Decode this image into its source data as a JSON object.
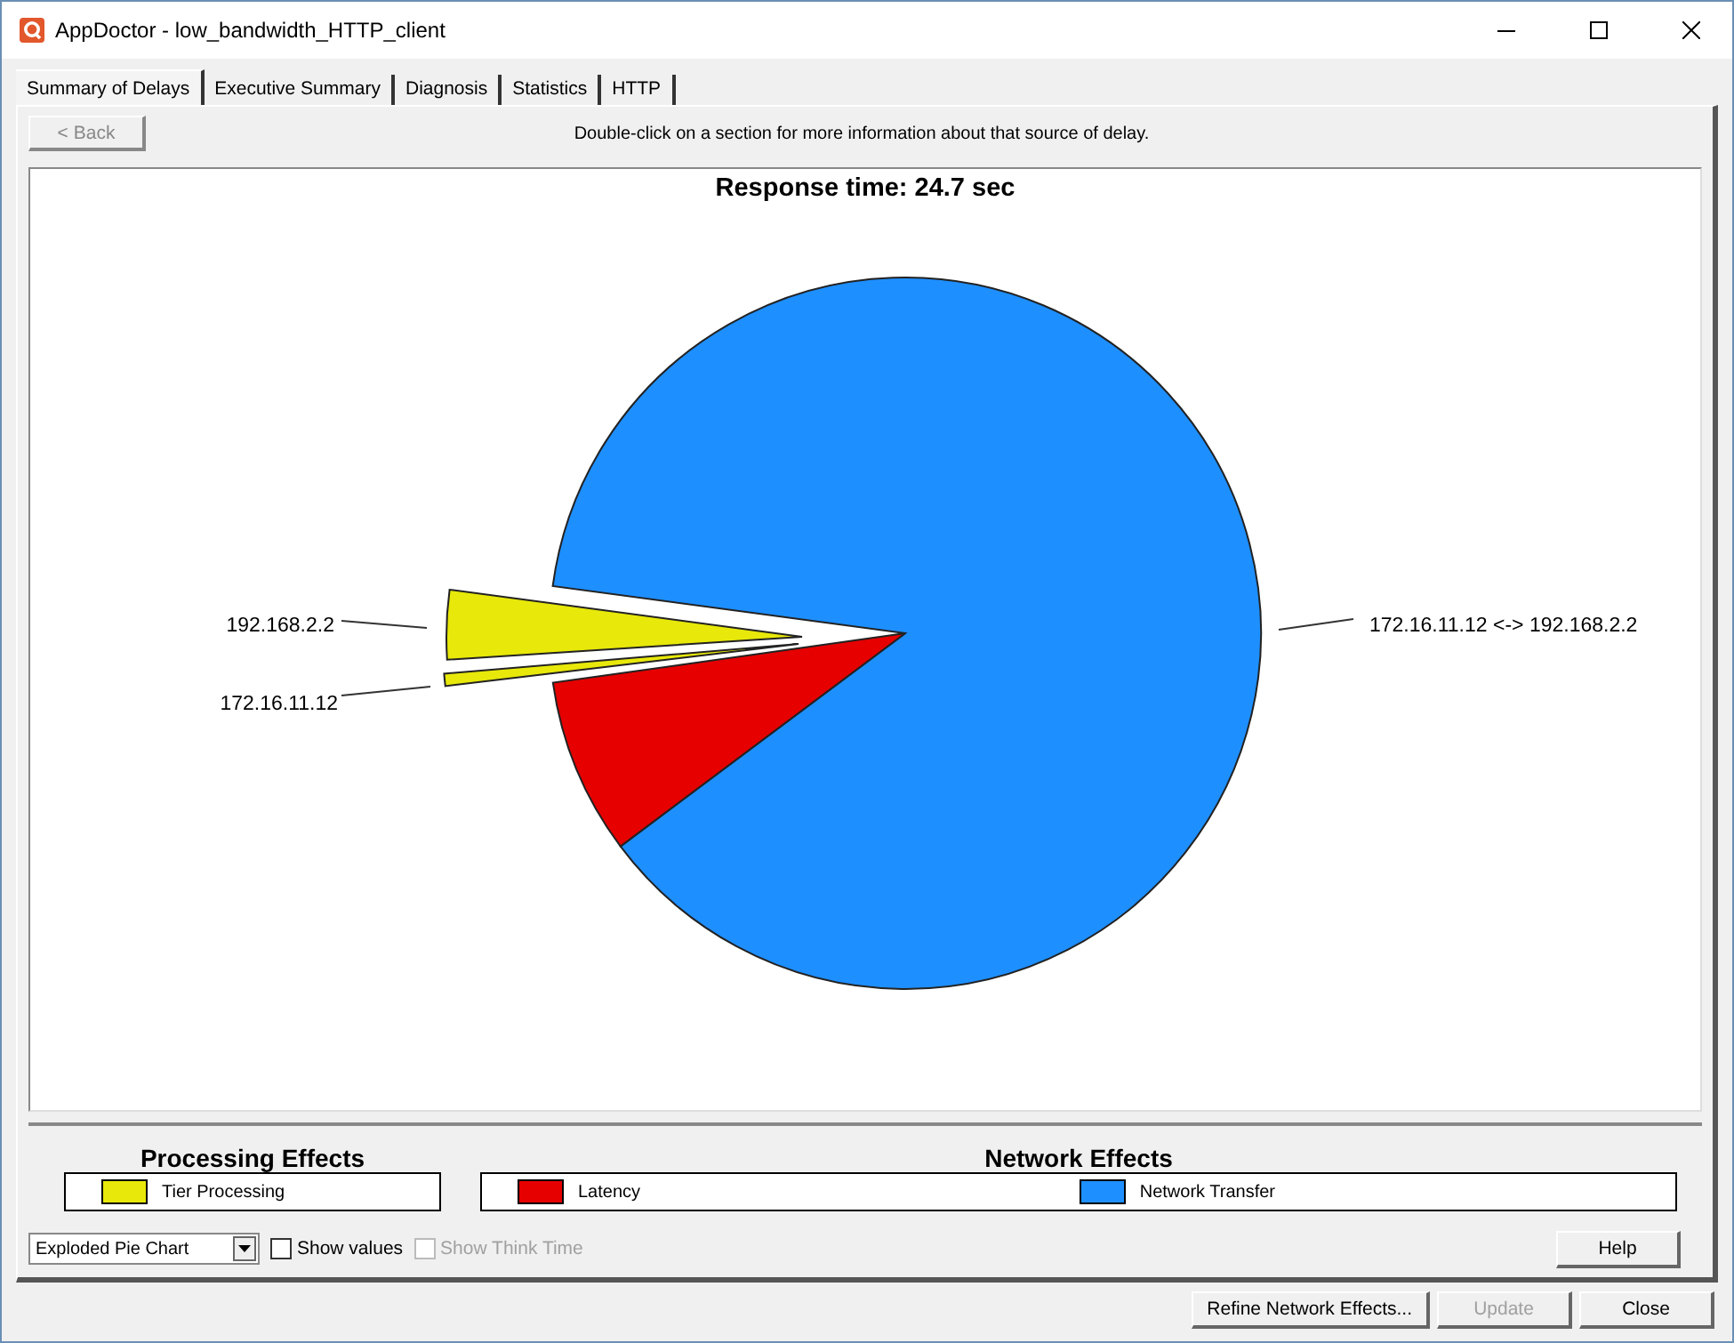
{
  "window": {
    "title": "AppDoctor - low_bandwidth_HTTP_client"
  },
  "tabs": [
    {
      "label": "Summary of Delays",
      "selected": true
    },
    {
      "label": "Executive Summary",
      "selected": false
    },
    {
      "label": "Diagnosis",
      "selected": false
    },
    {
      "label": "Statistics",
      "selected": false
    },
    {
      "label": "HTTP",
      "selected": false
    }
  ],
  "back_button": {
    "label": "< Back",
    "disabled": true
  },
  "hint": "Double-click on a section for more information about that source of delay.",
  "chart": {
    "title": "Response time: 24.7 sec",
    "labels": [
      "192.168.2.2",
      "172.16.11.12",
      "172.16.11.12 <-> 192.168.2.2"
    ]
  },
  "legend": [
    {
      "title": "Processing Effects",
      "items": [
        {
          "label": "Tier Processing",
          "color": "#e8e80a"
        }
      ]
    },
    {
      "title": "Network Effects",
      "items": [
        {
          "label": "Latency",
          "color": "#e60000"
        },
        {
          "label": "Network Transfer",
          "color": "#1e8fff"
        }
      ]
    }
  ],
  "chart_type": {
    "value": "Exploded Pie Chart"
  },
  "checkboxes": [
    {
      "label": "Show values",
      "checked": false,
      "disabled": false
    },
    {
      "label": "Show Think Time",
      "checked": false,
      "disabled": true
    }
  ],
  "help_button": {
    "label": "Help",
    "disabled": false
  },
  "buttons": [
    {
      "label": "Refine Network Effects...",
      "disabled": false
    },
    {
      "label": "Update",
      "disabled": true
    },
    {
      "label": "Close",
      "disabled": false
    }
  ]
}
